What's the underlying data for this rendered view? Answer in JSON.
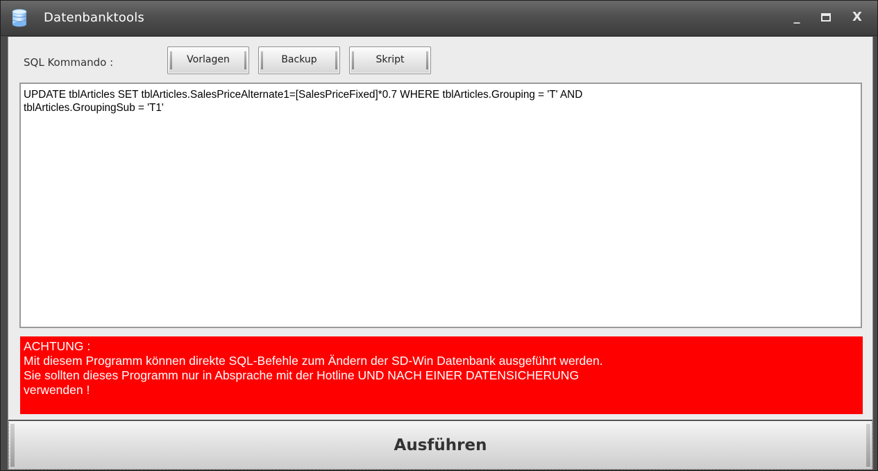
{
  "window": {
    "title": "Datenbanktools",
    "icon": "database-icon",
    "controls": {
      "minimize": "_",
      "maximize": "▭",
      "close": "X"
    }
  },
  "toolbar": {
    "label": "SQL Kommando :",
    "buttons": {
      "vorlagen": "Vorlagen",
      "backup": "Backup",
      "skript": "Skript"
    }
  },
  "editor": {
    "value": "UPDATE tblArticles SET tblArticles.SalesPriceAlternate1=[SalesPriceFixed]*0.7 WHERE tblArticles.Grouping = 'T' AND\ntblArticles.GroupingSub = 'T1'"
  },
  "warning": {
    "heading": "ACHTUNG :",
    "line1": "Mit diesem Programm können direkte SQL-Befehle zum Ändern der SD-Win Datenbank ausgeführt werden.",
    "line2": "Sie sollten dieses Programm nur in Absprache mit der Hotline UND NACH EINER DATENSICHERUNG",
    "line3": "verwenden !"
  },
  "execute": {
    "label": "Ausführen"
  },
  "colors": {
    "warning_background": "#ff0000",
    "titlebar": "#4f4f4f"
  }
}
